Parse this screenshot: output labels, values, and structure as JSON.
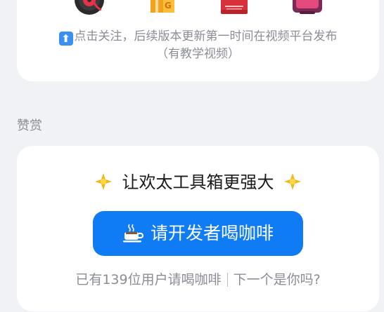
{
  "follow_card": {
    "platforms": [
      {
        "name": "music-platform-icon"
      },
      {
        "name": "gift-box-platform-icon"
      },
      {
        "name": "red-book-platform-icon"
      },
      {
        "name": "tv-platform-icon"
      }
    ],
    "notice_arrow": "⬆",
    "notice_line1": "点击关注，后续版本更新第一时间在视频平台发布",
    "notice_line2": "（有教学视频）"
  },
  "section": {
    "label": "赞赏"
  },
  "donate_card": {
    "headline": "让欢太工具箱更强大",
    "button_label": "请开发者喝咖啡",
    "footer_count_text": "已有139位用户请喝咖啡",
    "footer_link_text": "下一个是你吗?"
  },
  "colors": {
    "accent": "#0f7cf5",
    "page_bg": "#f1f2f6",
    "card_bg": "#ffffff",
    "muted_text": "#8b8d96"
  }
}
